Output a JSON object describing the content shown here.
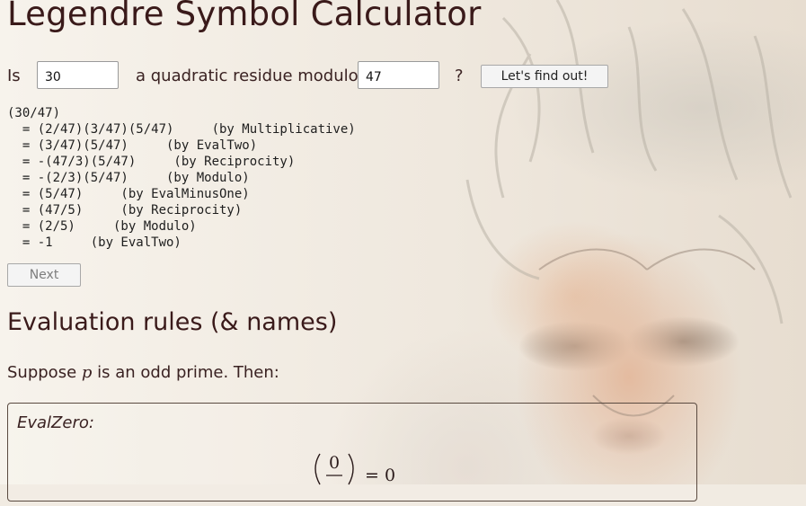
{
  "page": {
    "title": "Legendre Symbol Calculator"
  },
  "form": {
    "prefix": "Is",
    "a_value": "30",
    "middle_text": "a quadratic residue modulo",
    "p_value": "47",
    "suffix": "?",
    "submit_label": "Let's find out!"
  },
  "output": {
    "lines": [
      "(30/47)",
      "  = (2/47)(3/47)(5/47)     (by Multiplicative)",
      "  = (3/47)(5/47)     (by EvalTwo)",
      "  = -(47/3)(5/47)     (by Reciprocity)",
      "  = -(2/3)(5/47)     (by Modulo)",
      "  = (5/47)     (by EvalMinusOne)",
      "  = (47/5)     (by Reciprocity)",
      "  = (2/5)     (by Modulo)",
      "  = -1     (by EvalTwo)"
    ]
  },
  "next_label": "Next",
  "rules": {
    "heading": "Evaluation rules (& names)",
    "intro_before": "Suppose",
    "intro_var": "p",
    "intro_after": "is an odd prime. Then:",
    "items": [
      {
        "name": "EvalZero:",
        "formula": {
          "numerator": "0",
          "rhs": "= 0"
        }
      }
    ]
  },
  "colors": {
    "heading": "#3a1a1a",
    "text": "#3a2222",
    "background": "#f1ebe2"
  }
}
